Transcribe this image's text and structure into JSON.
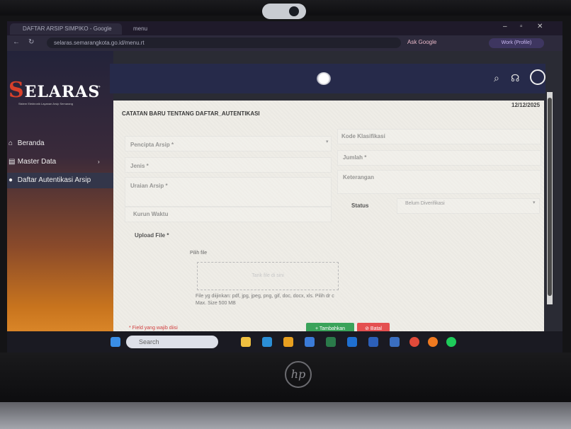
{
  "browser": {
    "tab_active": "DAFTAR ARSIP SIMPIKO - Google",
    "tab_second": "menu",
    "url": "selaras.semarangkota.go.id/menu.rt",
    "ask_google": "Ask Google",
    "profile": "Work (Profile)"
  },
  "sidebar": {
    "logo_initial": "S",
    "logo_rest": "ELARAS",
    "logo_subtitle": "Sistem Elektronik Layanan Arsip Semarang",
    "items": [
      {
        "label": "Beranda"
      },
      {
        "label": "Master Data"
      },
      {
        "label": "Daftar Autentikasi Arsip"
      }
    ]
  },
  "form": {
    "title": "CATATAN BARU TENTANG DAFTAR_AUTENTIKASI",
    "date": "12/12/2025",
    "fields": {
      "pencipta": "Pencipta Arsip *",
      "jenis": "Jenis *",
      "uraian": "Uraian Arsip *",
      "kurun": "Kurun Waktu",
      "upload": "Upload File *",
      "kode": "Kode Klasifikasi",
      "jumlah": "Jumlah *",
      "keterangan": "Keterangan",
      "status": "Status",
      "status_value": "Belum Diverifikasi"
    },
    "file_button": "Pilih file",
    "dropzone": "Tarik file di sini",
    "file_hint": "File yg diijinkan: pdf, jpg, jpeg, png, gif, doc, docx, xls. Pilih dr c Max. Size 500 MB",
    "required_note": "* Field yang wajib diisi",
    "btn_add": "Tambahkan",
    "btn_cancel": "Batal"
  },
  "taskbar": {
    "search": "Search"
  },
  "hardware": {
    "brand": "hp"
  }
}
